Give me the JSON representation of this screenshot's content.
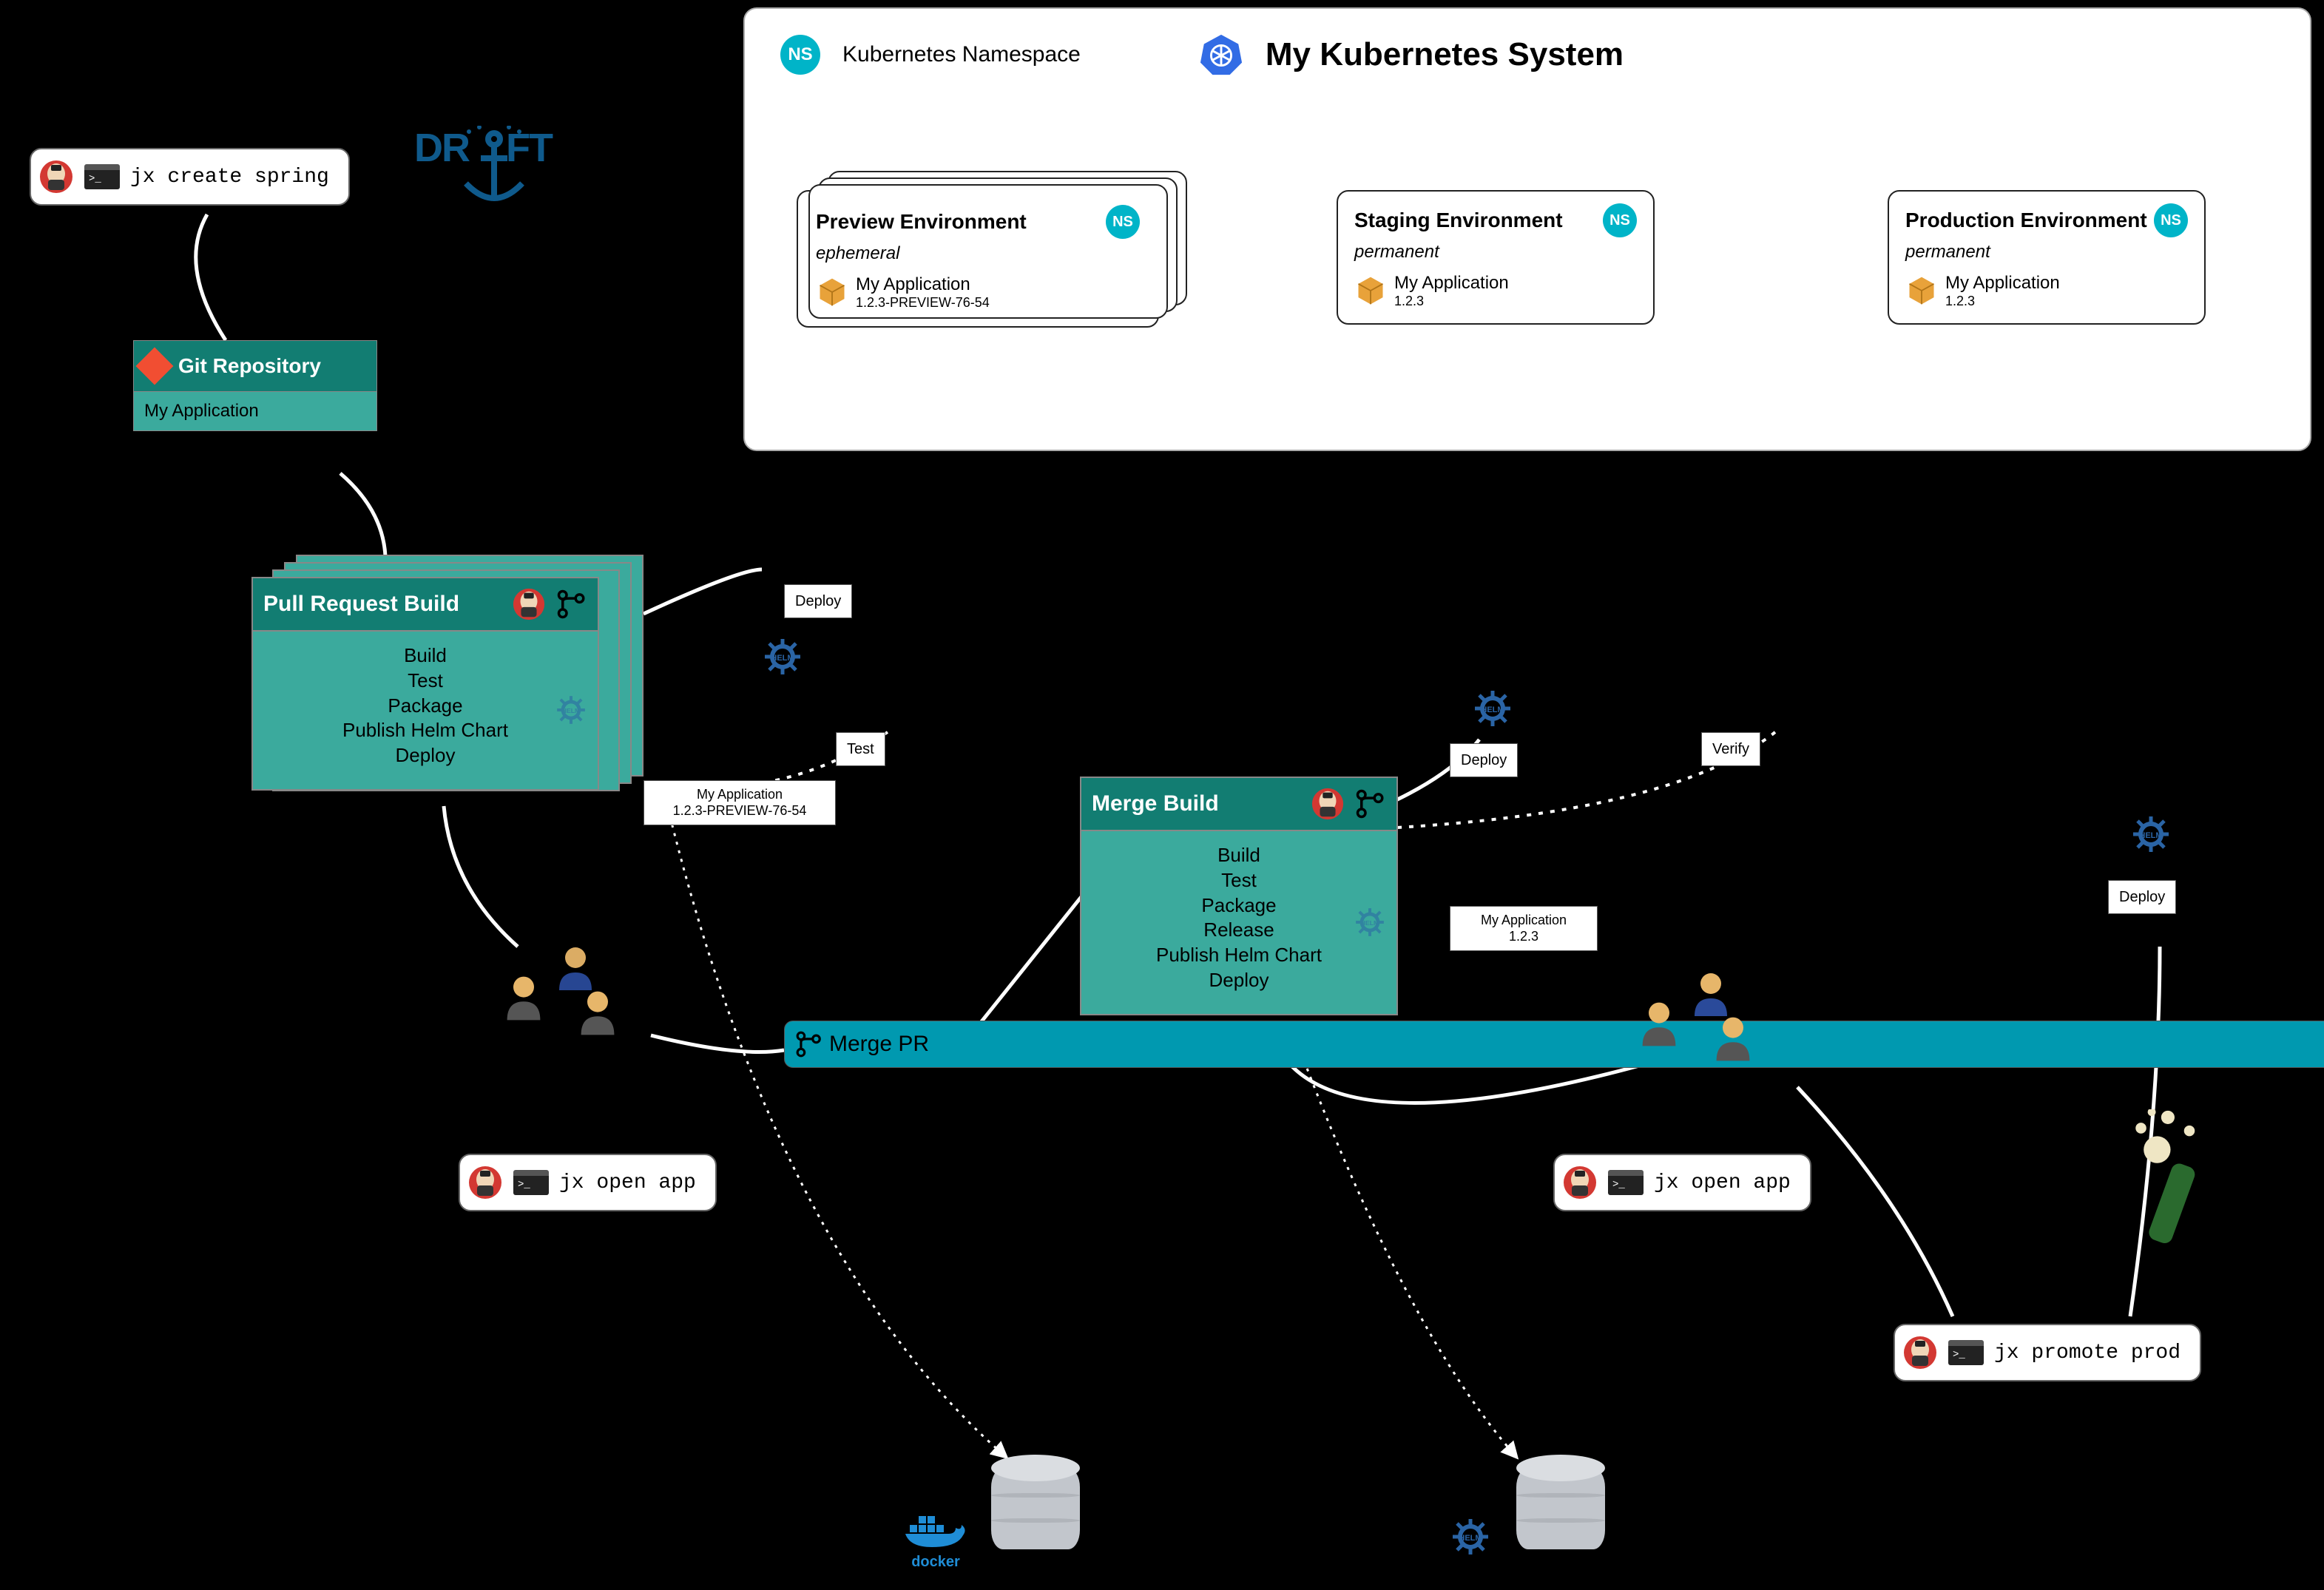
{
  "commands": {
    "create": "jx create spring",
    "openApp1": "jx open app",
    "openApp2": "jx open app",
    "promote": "jx promote prod"
  },
  "logos": {
    "draft": "DRAFT",
    "docker": "docker"
  },
  "gitRepo": {
    "title": "Git Repository",
    "app": "My Application"
  },
  "prBuild": {
    "title": "Pull Request Build",
    "steps": [
      "Build",
      "Test",
      "Package",
      "Publish Helm Chart",
      "Deploy"
    ]
  },
  "mergeBuild": {
    "title": "Merge Build",
    "steps": [
      "Build",
      "Test",
      "Package",
      "Release",
      "Publish Helm Chart",
      "Deploy"
    ]
  },
  "mergePr": "Merge PR",
  "artifacts": {
    "preview": {
      "name": "My Application",
      "version": "1.2.3-PREVIEW-76-54"
    },
    "release": {
      "name": "My Application",
      "version": "1.2.3"
    }
  },
  "tags": {
    "deploy": "Deploy",
    "test": "Test",
    "verify": "Verify"
  },
  "k8s": {
    "nsLabel": "Kubernetes Namespace",
    "nsBadge": "NS",
    "title": "My Kubernetes System",
    "envs": {
      "preview": {
        "name": "Preview Environment",
        "kind": "ephemeral",
        "app": "My Application",
        "version": "1.2.3-PREVIEW-76-54"
      },
      "staging": {
        "name": "Staging Environment",
        "kind": "permanent",
        "app": "My Application",
        "version": "1.2.3"
      },
      "production": {
        "name": "Production Environment",
        "kind": "permanent",
        "app": "My Application",
        "version": "1.2.3"
      }
    }
  }
}
